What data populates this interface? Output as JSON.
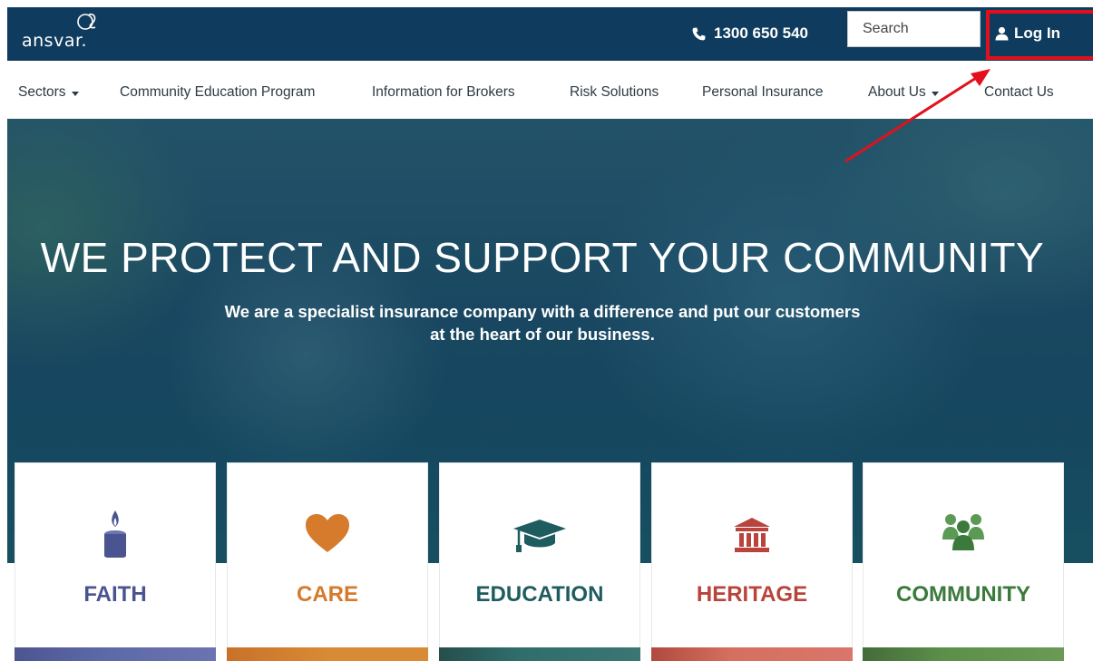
{
  "header": {
    "logo_text": "ansvar.",
    "phone": "1300 650 540",
    "search_placeholder": "Search",
    "login_label": "Log In"
  },
  "nav": {
    "items": [
      {
        "label": "Sectors",
        "has_dropdown": true
      },
      {
        "label": "Community Education Program",
        "has_dropdown": false
      },
      {
        "label": "Information for Brokers",
        "has_dropdown": false
      },
      {
        "label": "Risk Solutions",
        "has_dropdown": false
      },
      {
        "label": "Personal Insurance",
        "has_dropdown": false
      },
      {
        "label": "About Us",
        "has_dropdown": true
      },
      {
        "label": "Contact Us",
        "has_dropdown": false
      }
    ]
  },
  "hero": {
    "title": "WE PROTECT AND SUPPORT YOUR COMMUNITY",
    "subtitle": "We are a specialist insurance company with a difference and put our customers at the heart of our business."
  },
  "sectors": [
    {
      "label": "FAITH",
      "icon": "candle-icon",
      "color": "#4a5490",
      "bar_color": "#5c68a6"
    },
    {
      "label": "CARE",
      "icon": "heart-icon",
      "color": "#d67a2c",
      "bar_color": "#d98a34"
    },
    {
      "label": "EDUCATION",
      "icon": "graduation-cap-icon",
      "color": "#1f5c5f",
      "bar_color": "#2f6e6c"
    },
    {
      "label": "HERITAGE",
      "icon": "museum-icon",
      "color": "#b8443b",
      "bar_color": "#d5705f"
    },
    {
      "label": "COMMUNITY",
      "icon": "people-icon",
      "color": "#3b7a3b",
      "bar_color": "#5c8f4a"
    }
  ],
  "colors": {
    "header_bg": "#0e3b5e",
    "highlight": "#e3101c"
  }
}
